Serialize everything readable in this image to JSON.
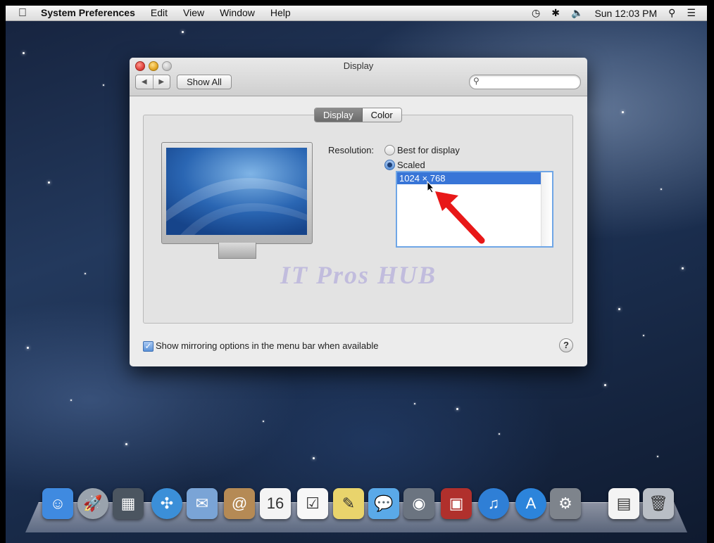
{
  "menubar": {
    "apple_icon": "",
    "app_name": "System Preferences",
    "items": [
      "Edit",
      "View",
      "Window",
      "Help"
    ],
    "clock": "Sun 12:03 PM",
    "status_icons": [
      "time-machine-icon",
      "bluetooth-icon",
      "volume-icon",
      "spotlight-icon",
      "notification-center-icon"
    ]
  },
  "window": {
    "title": "Display",
    "nav_back": "◀",
    "nav_forward": "▶",
    "show_all_label": "Show All",
    "search_placeholder": ""
  },
  "tabs": [
    {
      "label": "Display",
      "selected": true
    },
    {
      "label": "Color",
      "selected": false
    }
  ],
  "resolution": {
    "label": "Resolution:",
    "options": [
      {
        "label": "Best for display",
        "selected": false
      },
      {
        "label": "Scaled",
        "selected": true
      }
    ],
    "list": [
      "1024 × 768"
    ],
    "selected_value": "1024 × 768"
  },
  "watermark": "IT Pros HUB",
  "mirroring_checkbox": {
    "label": "Show mirroring options in the menu bar when available",
    "checked": true
  },
  "help_label": "?",
  "dock": [
    {
      "name": "finder-icon",
      "glyph": "☺",
      "color": "#3f8ae0"
    },
    {
      "name": "launchpad-icon",
      "glyph": "🚀",
      "color": "#9aa3ad"
    },
    {
      "name": "mission-control-icon",
      "glyph": "▦",
      "color": "#4b5560"
    },
    {
      "name": "safari-icon",
      "glyph": "✣",
      "color": "#3b8fd8"
    },
    {
      "name": "mail-icon",
      "glyph": "✉",
      "color": "#7aa4d6"
    },
    {
      "name": "contacts-icon",
      "glyph": "@",
      "color": "#b58a55"
    },
    {
      "name": "calendar-icon",
      "glyph": "16",
      "color": "#f4f4f4"
    },
    {
      "name": "reminders-icon",
      "glyph": "☑",
      "color": "#f7f7f7"
    },
    {
      "name": "notes-icon",
      "glyph": "✎",
      "color": "#e9d46c"
    },
    {
      "name": "messages-icon",
      "glyph": "💬",
      "color": "#5aa9e8"
    },
    {
      "name": "facetime-icon",
      "glyph": "◉",
      "color": "#6b7480"
    },
    {
      "name": "photo-booth-icon",
      "glyph": "▣",
      "color": "#b0302c"
    },
    {
      "name": "itunes-icon",
      "glyph": "♫",
      "color": "#2f7fd6"
    },
    {
      "name": "app-store-icon",
      "glyph": "A",
      "color": "#2c84db"
    },
    {
      "name": "system-preferences-icon",
      "glyph": "⚙",
      "color": "#7e848c"
    },
    {
      "name": "document-icon",
      "glyph": "▤",
      "color": "#f4f4f4"
    },
    {
      "name": "trash-icon",
      "glyph": "🗑",
      "color": "#b9bec5"
    }
  ]
}
